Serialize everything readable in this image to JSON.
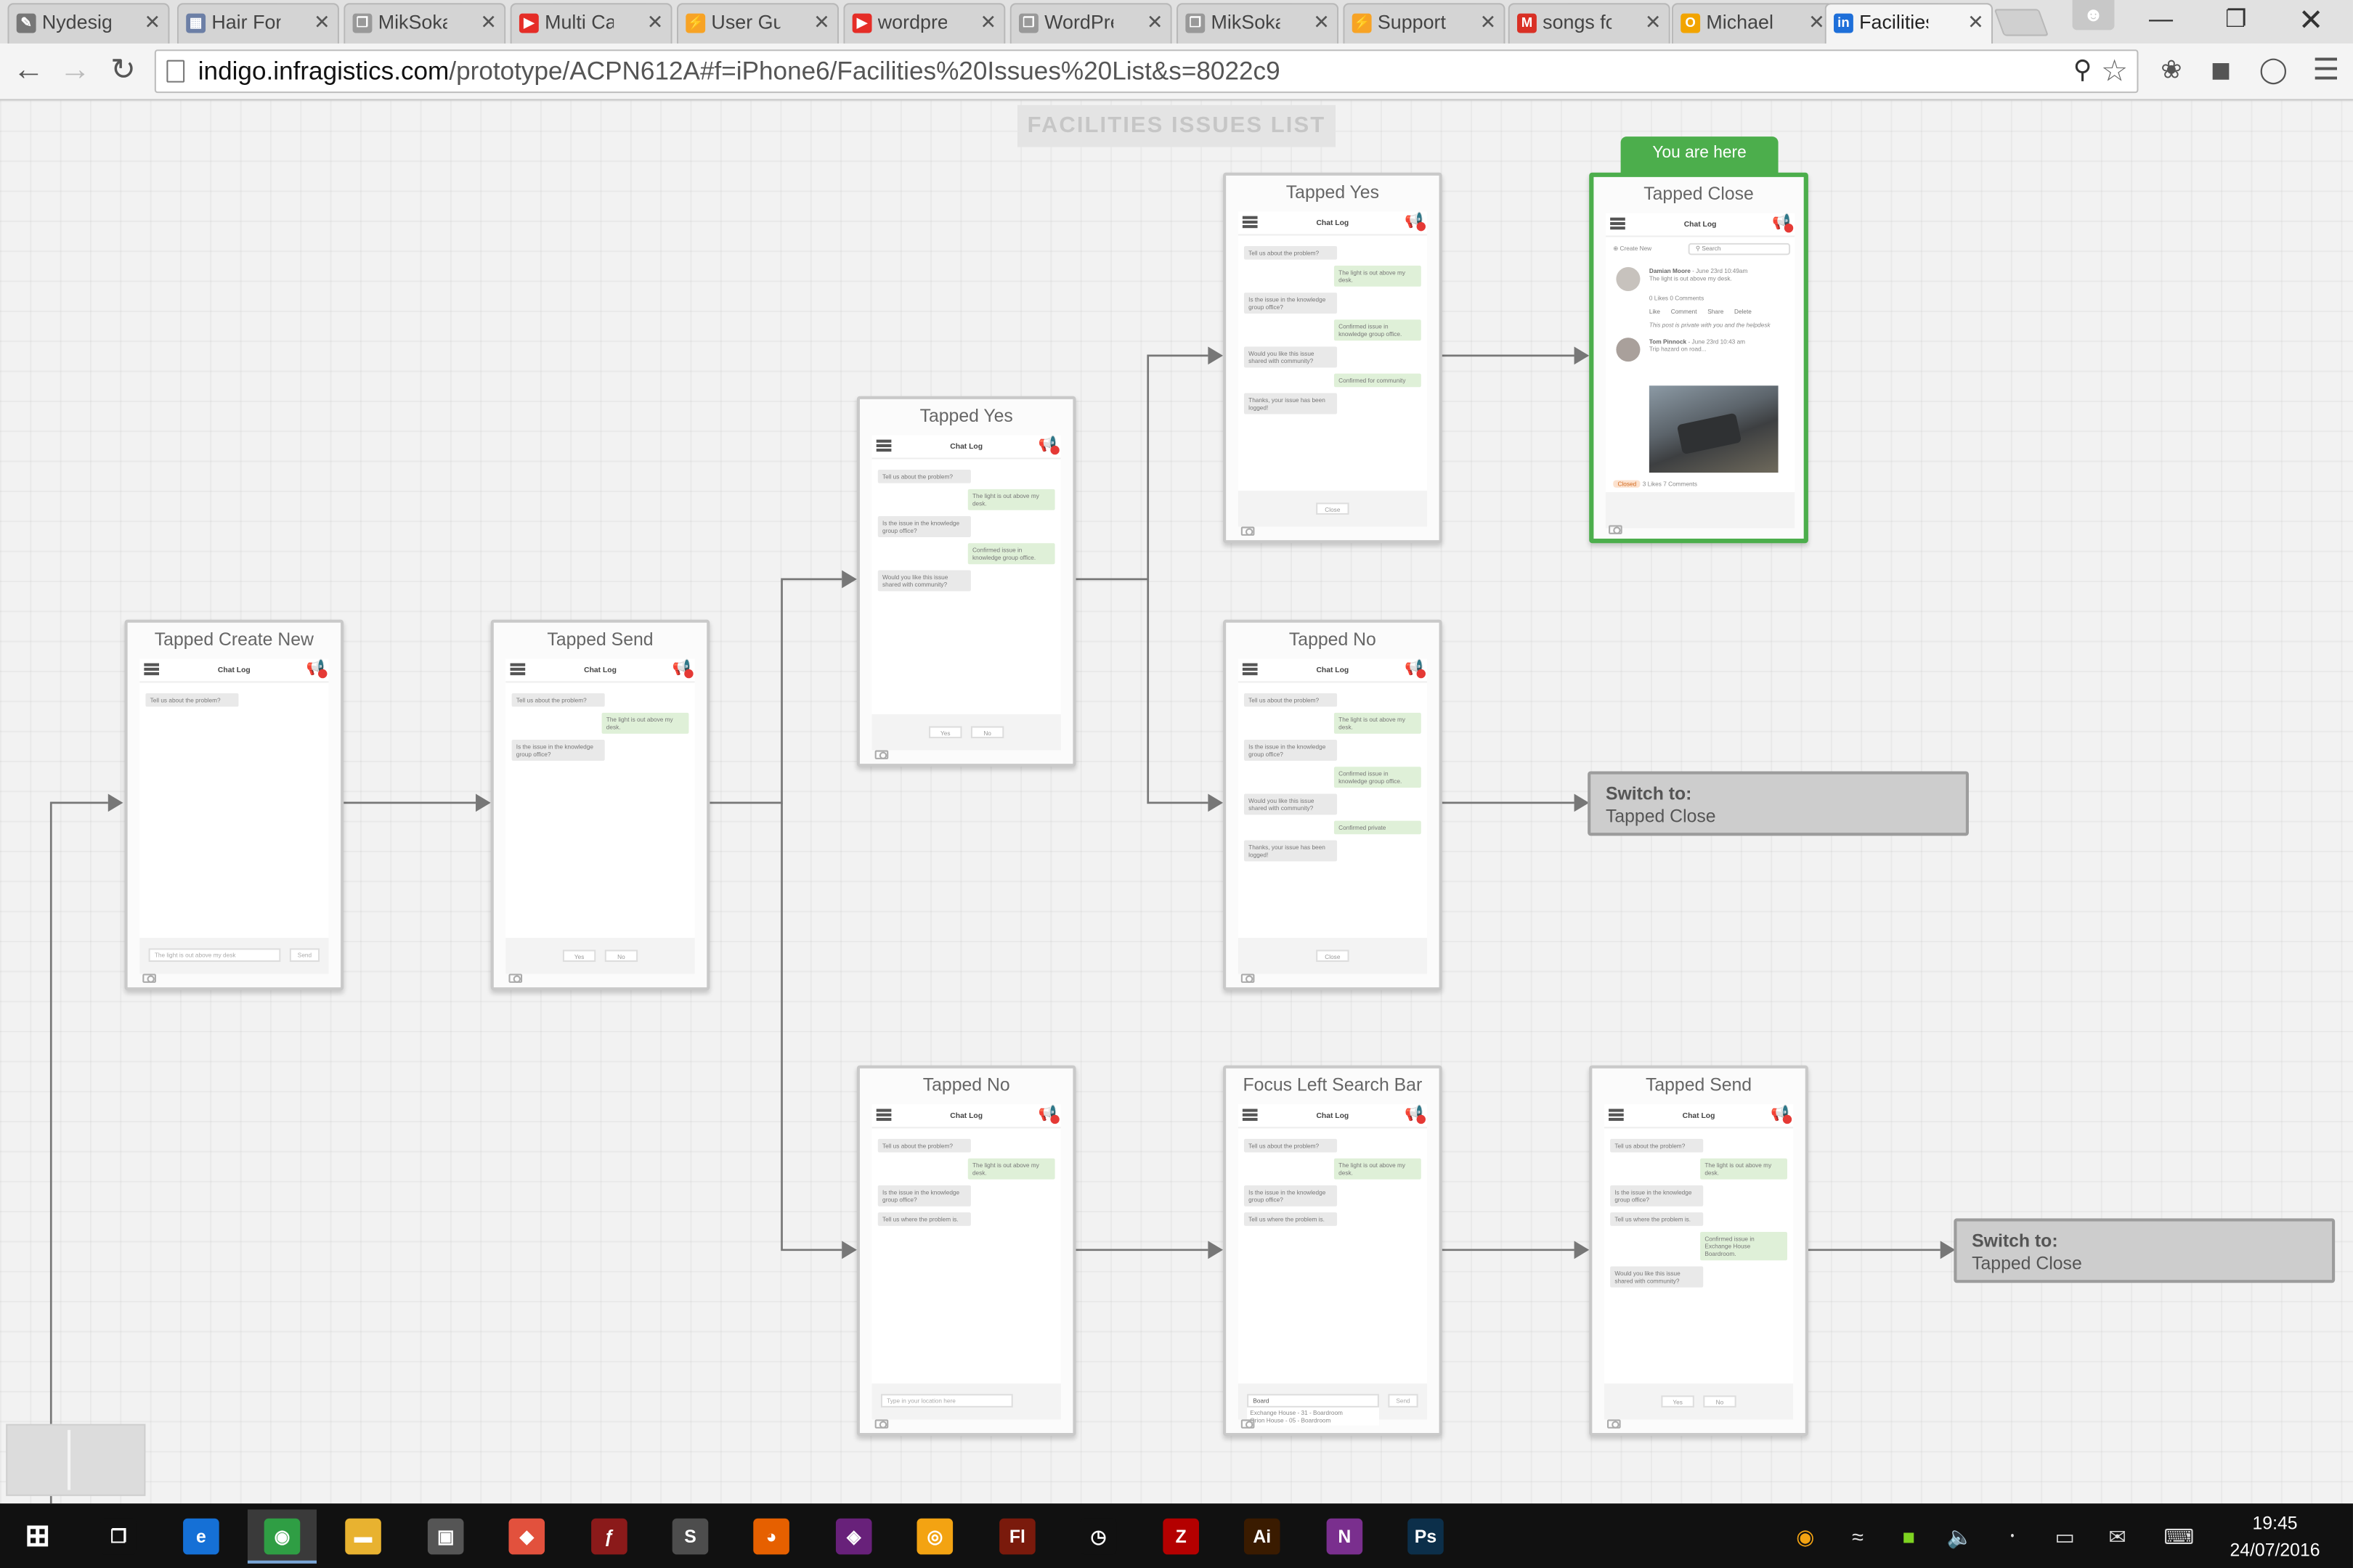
{
  "browser": {
    "tabs": [
      {
        "title": "Nydesign",
        "fav": "#777",
        "glyph": "✎"
      },
      {
        "title": "Hair Force",
        "fav": "#6c7fa6",
        "glyph": "▦"
      },
      {
        "title": "MikSokal",
        "fav": "#999",
        "glyph": "❐"
      },
      {
        "title": "Multi Ca",
        "fav": "#e52d27",
        "glyph": "▶"
      },
      {
        "title": "User Gui",
        "fav": "#f7a325",
        "glyph": "⚡"
      },
      {
        "title": "wordpre",
        "fav": "#e52d27",
        "glyph": "▶"
      },
      {
        "title": "WordPre",
        "fav": "#999",
        "glyph": "❐"
      },
      {
        "title": "MikSokal",
        "fav": "#999",
        "glyph": "❐"
      },
      {
        "title": "Support",
        "fav": "#f7a325",
        "glyph": "⚡"
      },
      {
        "title": "songs fo",
        "fav": "#d93025",
        "glyph": "M"
      },
      {
        "title": "Michael",
        "fav": "#f2a400",
        "glyph": "O"
      },
      {
        "title": "Facilities",
        "fav": "#1e6fd9",
        "glyph": "in"
      }
    ],
    "url_host": "indigo.infragistics.com",
    "url_path": "/prototype/ACPN612A#f=iPhone6/Facilities%20Issues%20List&s=8022c9"
  },
  "prototype": {
    "page_title": "FACILITIES ISSUES LIST",
    "you_are_here": "You are here",
    "switch_to_label": "Switch to:",
    "switch_target": "Tapped Close",
    "chat_log": "Chat Log",
    "screens": {
      "s1": {
        "caption": "Tapped Create New",
        "messages": [
          {
            "who": "b",
            "text": "Tell us about the problem?"
          }
        ],
        "input_placeholder": "The light is out above my desk",
        "send": "Send"
      },
      "s2": {
        "caption": "Tapped Send",
        "messages": [
          {
            "who": "b",
            "text": "Tell us about the problem?"
          },
          {
            "who": "u",
            "text": "The light is out above my desk."
          },
          {
            "who": "b",
            "text": "Is the issue in the knowledge group office?"
          }
        ],
        "buttons": [
          "Yes",
          "No"
        ]
      },
      "s3": {
        "caption": "Tapped Yes",
        "messages": [
          {
            "who": "b",
            "text": "Tell us about the problem?"
          },
          {
            "who": "u",
            "text": "The light is out above my desk."
          },
          {
            "who": "b",
            "text": "Is the issue in the knowledge group office?"
          },
          {
            "who": "u",
            "text": "Confirmed issue in knowledge group office."
          },
          {
            "who": "b",
            "text": "Would you like this issue shared with community?"
          }
        ],
        "buttons": [
          "Yes",
          "No"
        ]
      },
      "s4": {
        "caption": "Tapped Yes",
        "messages": [
          {
            "who": "b",
            "text": "Tell us about the problem?"
          },
          {
            "who": "u",
            "text": "The light is out above my desk."
          },
          {
            "who": "b",
            "text": "Is the issue in the knowledge group office?"
          },
          {
            "who": "u",
            "text": "Confirmed issue in knowledge group office."
          },
          {
            "who": "b",
            "text": "Would you like this issue shared with community?"
          },
          {
            "who": "u",
            "text": "Confirmed for community"
          },
          {
            "who": "b",
            "text": "Thanks, your issue has been logged!"
          }
        ],
        "buttons": [
          "Close"
        ]
      },
      "s5": {
        "caption": "Tapped No",
        "messages": [
          {
            "who": "b",
            "text": "Tell us about the problem?"
          },
          {
            "who": "u",
            "text": "The light is out above my desk."
          },
          {
            "who": "b",
            "text": "Is the issue in the knowledge group office?"
          },
          {
            "who": "u",
            "text": "Confirmed issue in knowledge group office."
          },
          {
            "who": "b",
            "text": "Would you like this issue shared with community?"
          },
          {
            "who": "u",
            "text": "Confirmed private"
          },
          {
            "who": "b",
            "text": "Thanks, your issue has been logged!"
          }
        ],
        "buttons": [
          "Close"
        ]
      },
      "s6": {
        "caption": "Tapped Close",
        "create_new": "Create New",
        "search": "Search",
        "post1": {
          "name": "Damian Moore",
          "meta": "June 23rd 10:49am",
          "text": "The light is out above my desk.",
          "stats": "0 Likes  0 Comments",
          "note": "This post is private with you and the helpdesk"
        },
        "post2": {
          "name": "Tom Pinnock",
          "meta": "June 23rd 10:43 am",
          "text": "Trip hazard on road...",
          "tag": "Closed",
          "stats": "3 Likes  7 Comments"
        },
        "actions": "Like Comment Share Delete"
      },
      "s7": {
        "caption": "Tapped No",
        "messages": [
          {
            "who": "b",
            "text": "Tell us about the problem?"
          },
          {
            "who": "u",
            "text": "The light is out above my desk."
          },
          {
            "who": "b",
            "text": "Is the issue in the knowledge group office?"
          },
          {
            "who": "b",
            "text": "Tell us where the problem is."
          }
        ],
        "input_placeholder": "Type in your location here"
      },
      "s8": {
        "caption": "Focus Left Search Bar",
        "messages": [
          {
            "who": "b",
            "text": "Tell us about the problem?"
          },
          {
            "who": "u",
            "text": "The light is out above my desk."
          },
          {
            "who": "b",
            "text": "Is the issue in the knowledge group office?"
          },
          {
            "who": "b",
            "text": "Tell us where the problem is."
          }
        ],
        "input_value": "Board",
        "send": "Send",
        "suggestions": [
          "Exchange House - 31 - Boardroom",
          "Orion House - 05 - Boardroom"
        ]
      },
      "s9": {
        "caption": "Tapped Send",
        "messages": [
          {
            "who": "b",
            "text": "Tell us about the problem?"
          },
          {
            "who": "u",
            "text": "The light is out above my desk."
          },
          {
            "who": "b",
            "text": "Is the issue in the knowledge group office?"
          },
          {
            "who": "b",
            "text": "Tell us where the problem is."
          },
          {
            "who": "u",
            "text": "Confirmed issue in Exchange House Boardroom."
          },
          {
            "who": "b",
            "text": "Would you like this issue shared with community?"
          }
        ],
        "buttons": [
          "Yes",
          "No"
        ]
      }
    }
  },
  "taskbar": {
    "apps": [
      {
        "name": "task-view",
        "color": "#111",
        "glyph": "❐"
      },
      {
        "name": "edge",
        "color": "#1570d6",
        "glyph": "e"
      },
      {
        "name": "chrome",
        "color": "#2f9e44",
        "glyph": "◉"
      },
      {
        "name": "file-explorer",
        "color": "#e8b230",
        "glyph": "▬"
      },
      {
        "name": "store",
        "color": "#555",
        "glyph": "▣"
      },
      {
        "name": "git",
        "color": "#e2513d",
        "glyph": "◆"
      },
      {
        "name": "flash-player",
        "color": "#8b1a1a",
        "glyph": "ƒ"
      },
      {
        "name": "sublime",
        "color": "#4d4d4d",
        "glyph": "S"
      },
      {
        "name": "firefox",
        "color": "#e66000",
        "glyph": "◕"
      },
      {
        "name": "vs",
        "color": "#68217a",
        "glyph": "◈"
      },
      {
        "name": "circle-app",
        "color": "#f3a312",
        "glyph": "◎"
      },
      {
        "name": "flash",
        "color": "#7a1a0c",
        "glyph": "Fl"
      },
      {
        "name": "wunderlist",
        "color": "#111",
        "glyph": "◷"
      },
      {
        "name": "filezilla",
        "color": "#b40000",
        "glyph": "Z"
      },
      {
        "name": "illustrator",
        "color": "#3a1b00",
        "glyph": "Ai"
      },
      {
        "name": "onenote",
        "color": "#7a2f8e",
        "glyph": "N"
      },
      {
        "name": "photoshop",
        "color": "#0c2f4a",
        "glyph": "Ps"
      }
    ],
    "time": "19:45",
    "date": "24/07/2016"
  }
}
